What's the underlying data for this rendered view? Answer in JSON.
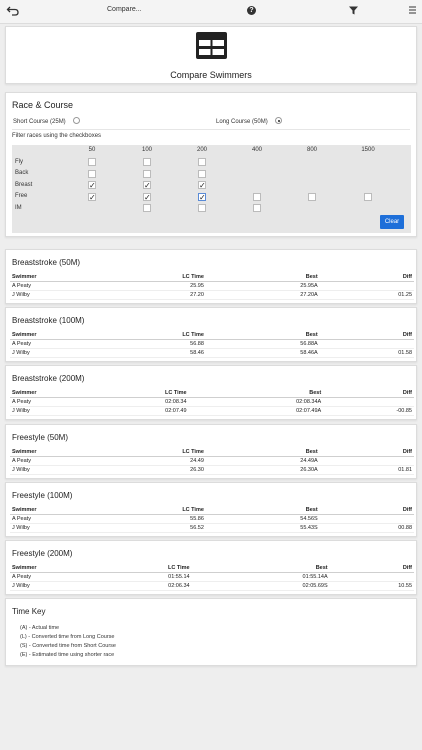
{
  "topbar": {
    "title": "Compare...",
    "help": "?"
  },
  "header": {
    "heading": "Compare Swimmers"
  },
  "race": {
    "title": "Race & Course",
    "short_course": "Short Course (25M)",
    "long_course": "Long Course (50M)",
    "selected_course": "long",
    "filter_hint": "Filter races using the checkboxes",
    "distances": [
      "50",
      "100",
      "200",
      "400",
      "800",
      "1500"
    ],
    "strokes": [
      {
        "label": "Fly",
        "boxes": [
          false,
          false,
          false,
          null,
          null,
          null
        ]
      },
      {
        "label": "Back",
        "boxes": [
          false,
          false,
          false,
          null,
          null,
          null
        ]
      },
      {
        "label": "Breast",
        "boxes": [
          true,
          true,
          true,
          null,
          null,
          null
        ]
      },
      {
        "label": "Free",
        "boxes": [
          true,
          true,
          true,
          false,
          false,
          false
        ]
      },
      {
        "label": "IM",
        "boxes": [
          null,
          false,
          false,
          false,
          null,
          null
        ]
      }
    ],
    "clear_label": "Clear"
  },
  "columns": {
    "swimmer": "Swimmer",
    "lc_time": "LC Time",
    "best": "Best",
    "diff": "Diff"
  },
  "results": [
    {
      "title": "Breaststroke (50M)",
      "rows": [
        {
          "swimmer": "A Peaty",
          "lc_time": "25.95",
          "best": "25.95A",
          "diff": ""
        },
        {
          "swimmer": "J Wilby",
          "lc_time": "27.20",
          "best": "27.20A",
          "diff": "01.25"
        }
      ]
    },
    {
      "title": "Breaststroke (100M)",
      "rows": [
        {
          "swimmer": "A Peaty",
          "lc_time": "56.88",
          "best": "56.88A",
          "diff": ""
        },
        {
          "swimmer": "J Wilby",
          "lc_time": "58.46",
          "best": "58.46A",
          "diff": "01.58"
        }
      ]
    },
    {
      "title": "Breaststroke (200M)",
      "rows": [
        {
          "swimmer": "A Peaty",
          "lc_time": "02:08.34",
          "best": "02:08.34A",
          "diff": ""
        },
        {
          "swimmer": "J Wilby",
          "lc_time": "02:07.49",
          "best": "02:07.49A",
          "diff": "-00.85"
        }
      ]
    },
    {
      "title": "Freestyle (50M)",
      "rows": [
        {
          "swimmer": "A Peaty",
          "lc_time": "24.49",
          "best": "24.49A",
          "diff": ""
        },
        {
          "swimmer": "J Wilby",
          "lc_time": "26.30",
          "best": "26.30A",
          "diff": "01.81"
        }
      ]
    },
    {
      "title": "Freestyle (100M)",
      "rows": [
        {
          "swimmer": "A Peaty",
          "lc_time": "55.86",
          "best": "54.56S",
          "diff": ""
        },
        {
          "swimmer": "J Wilby",
          "lc_time": "56.52",
          "best": "55.43S",
          "diff": "00.88"
        }
      ]
    },
    {
      "title": "Freestyle (200M)",
      "rows": [
        {
          "swimmer": "A Peaty",
          "lc_time": "01:55.14",
          "best": "01:55.14A",
          "diff": ""
        },
        {
          "swimmer": "J Wilby",
          "lc_time": "02:06.34",
          "best": "02:05.69S",
          "diff": "10.55"
        }
      ]
    }
  ],
  "time_key": {
    "title": "Time Key",
    "lines": [
      "(A) - Actual time",
      "(L) - Converted time from Long Course",
      "(S) - Converted time from Short Course",
      "(E) - Estimated time using shorter race"
    ]
  },
  "colors": {
    "accent": "#1e6fd9",
    "background": "#eeeeee",
    "grid": "#e6e6e6"
  }
}
